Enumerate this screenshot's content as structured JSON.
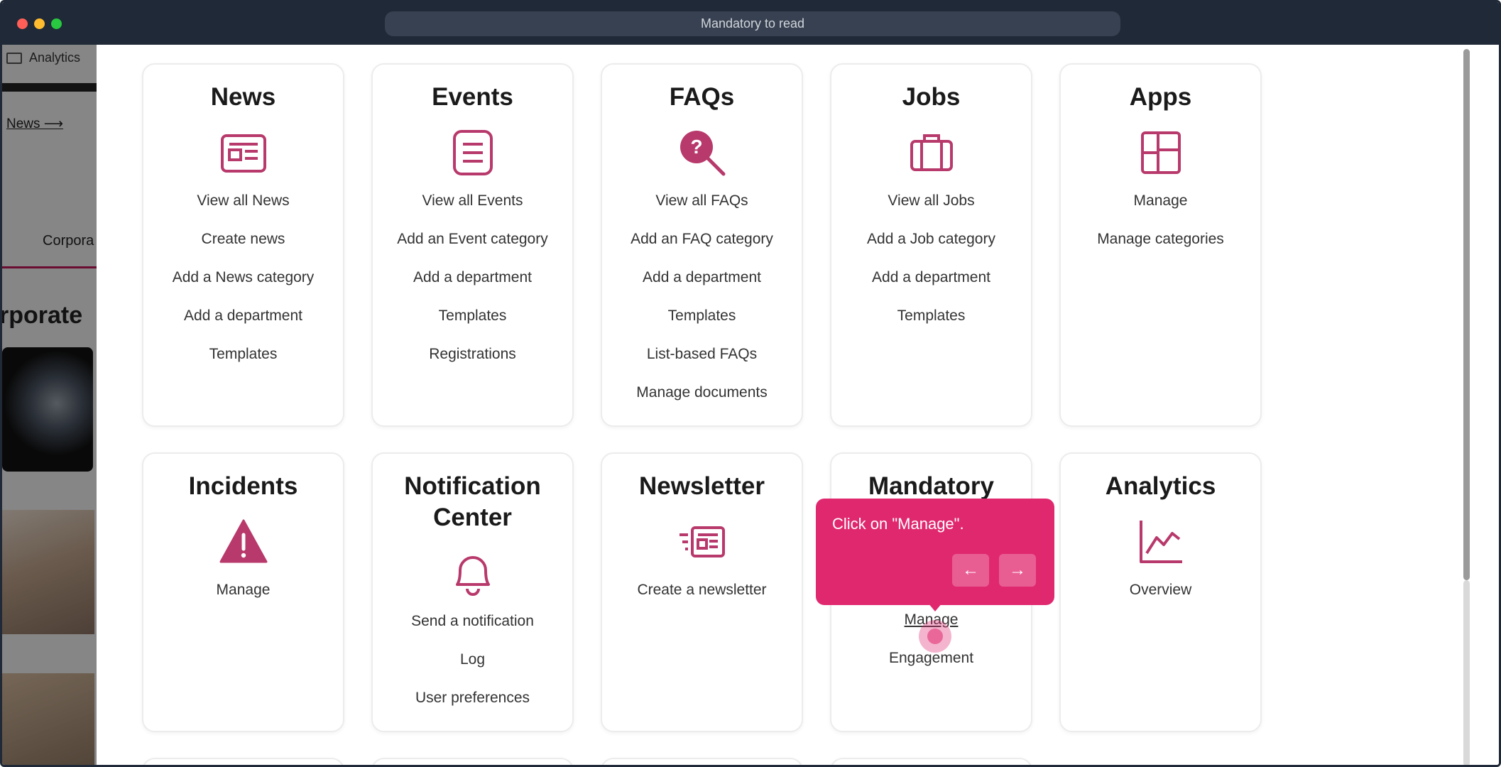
{
  "window": {
    "title": "Mandatory to read"
  },
  "background": {
    "analytics_label": "Analytics",
    "news_link": "News ⟶",
    "corpora_tab": "Corpora",
    "heading_fragment": "rporate"
  },
  "cards": [
    {
      "title": "News",
      "icon": "newspaper-icon",
      "links": [
        "View all News",
        "Create news",
        "Add a News category",
        "Add a department",
        "Templates"
      ]
    },
    {
      "title": "Events",
      "icon": "list-document-icon",
      "links": [
        "View all Events",
        "Add an Event category",
        "Add a department",
        "Templates",
        "Registrations"
      ]
    },
    {
      "title": "FAQs",
      "icon": "question-search-icon",
      "links": [
        "View all FAQs",
        "Add an FAQ category",
        "Add a department",
        "Templates",
        "List-based FAQs",
        "Manage documents"
      ]
    },
    {
      "title": "Jobs",
      "icon": "briefcase-icon",
      "links": [
        "View all Jobs",
        "Add a Job category",
        "Add a department",
        "Templates"
      ]
    },
    {
      "title": "Apps",
      "icon": "apps-grid-icon",
      "links": [
        "Manage",
        "Manage categories"
      ]
    },
    {
      "title": "Incidents",
      "icon": "warning-icon",
      "links": [
        "Manage"
      ]
    },
    {
      "title": "Notification Center",
      "icon": "bell-icon",
      "links": [
        "Send a notification",
        "Log",
        "User preferences"
      ]
    },
    {
      "title": "Newsletter",
      "icon": "newsletter-icon",
      "links": [
        "Create a newsletter"
      ]
    },
    {
      "title": "Mandatory",
      "icon": "mandatory-icon",
      "links": [
        "Manage",
        "Engagement"
      ]
    },
    {
      "title": "Analytics",
      "icon": "line-chart-icon",
      "links": [
        "Overview"
      ]
    }
  ],
  "tooltip": {
    "text": "Click on \"Manage\".",
    "prev_icon": "arrow-left-icon",
    "next_icon": "arrow-right-icon"
  },
  "colors": {
    "accent": "#b8396b",
    "tooltip": "#e0286f",
    "titlebar": "#1f2937"
  }
}
